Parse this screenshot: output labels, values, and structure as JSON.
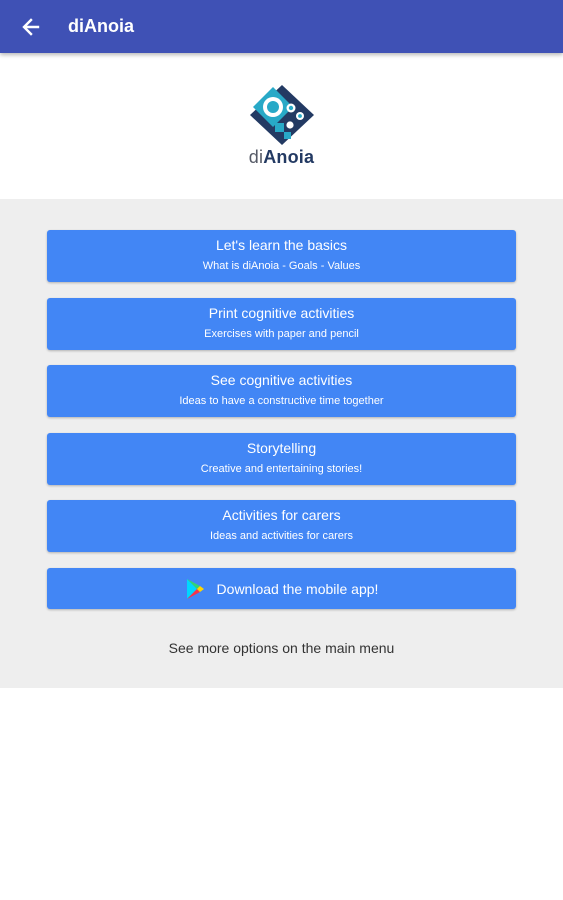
{
  "appbar": {
    "title": "diAnoia",
    "back_icon": "arrow-left-icon",
    "color": "#3f51b5"
  },
  "logo": {
    "text_prefix": "di",
    "text_rest": "Anoia",
    "colors": {
      "teal": "#28a9c7",
      "navy": "#233a63"
    }
  },
  "menu": {
    "button_color": "#4286f5",
    "items": [
      {
        "title": "Let's learn the basics",
        "subtitle": "What is diAnoia - Goals - Values"
      },
      {
        "title": "Print cognitive activities",
        "subtitle": "Exercises with paper and pencil"
      },
      {
        "title": "See cognitive activities",
        "subtitle": "Ideas to have a constructive time together"
      },
      {
        "title": "Storytelling",
        "subtitle": "Creative and entertaining stories!"
      },
      {
        "title": "Activities for carers",
        "subtitle": "Ideas and activities for carers"
      }
    ],
    "download": {
      "label": "Download the mobile app!",
      "icon": "google-play-icon"
    },
    "footer": "See more options on the main menu"
  }
}
